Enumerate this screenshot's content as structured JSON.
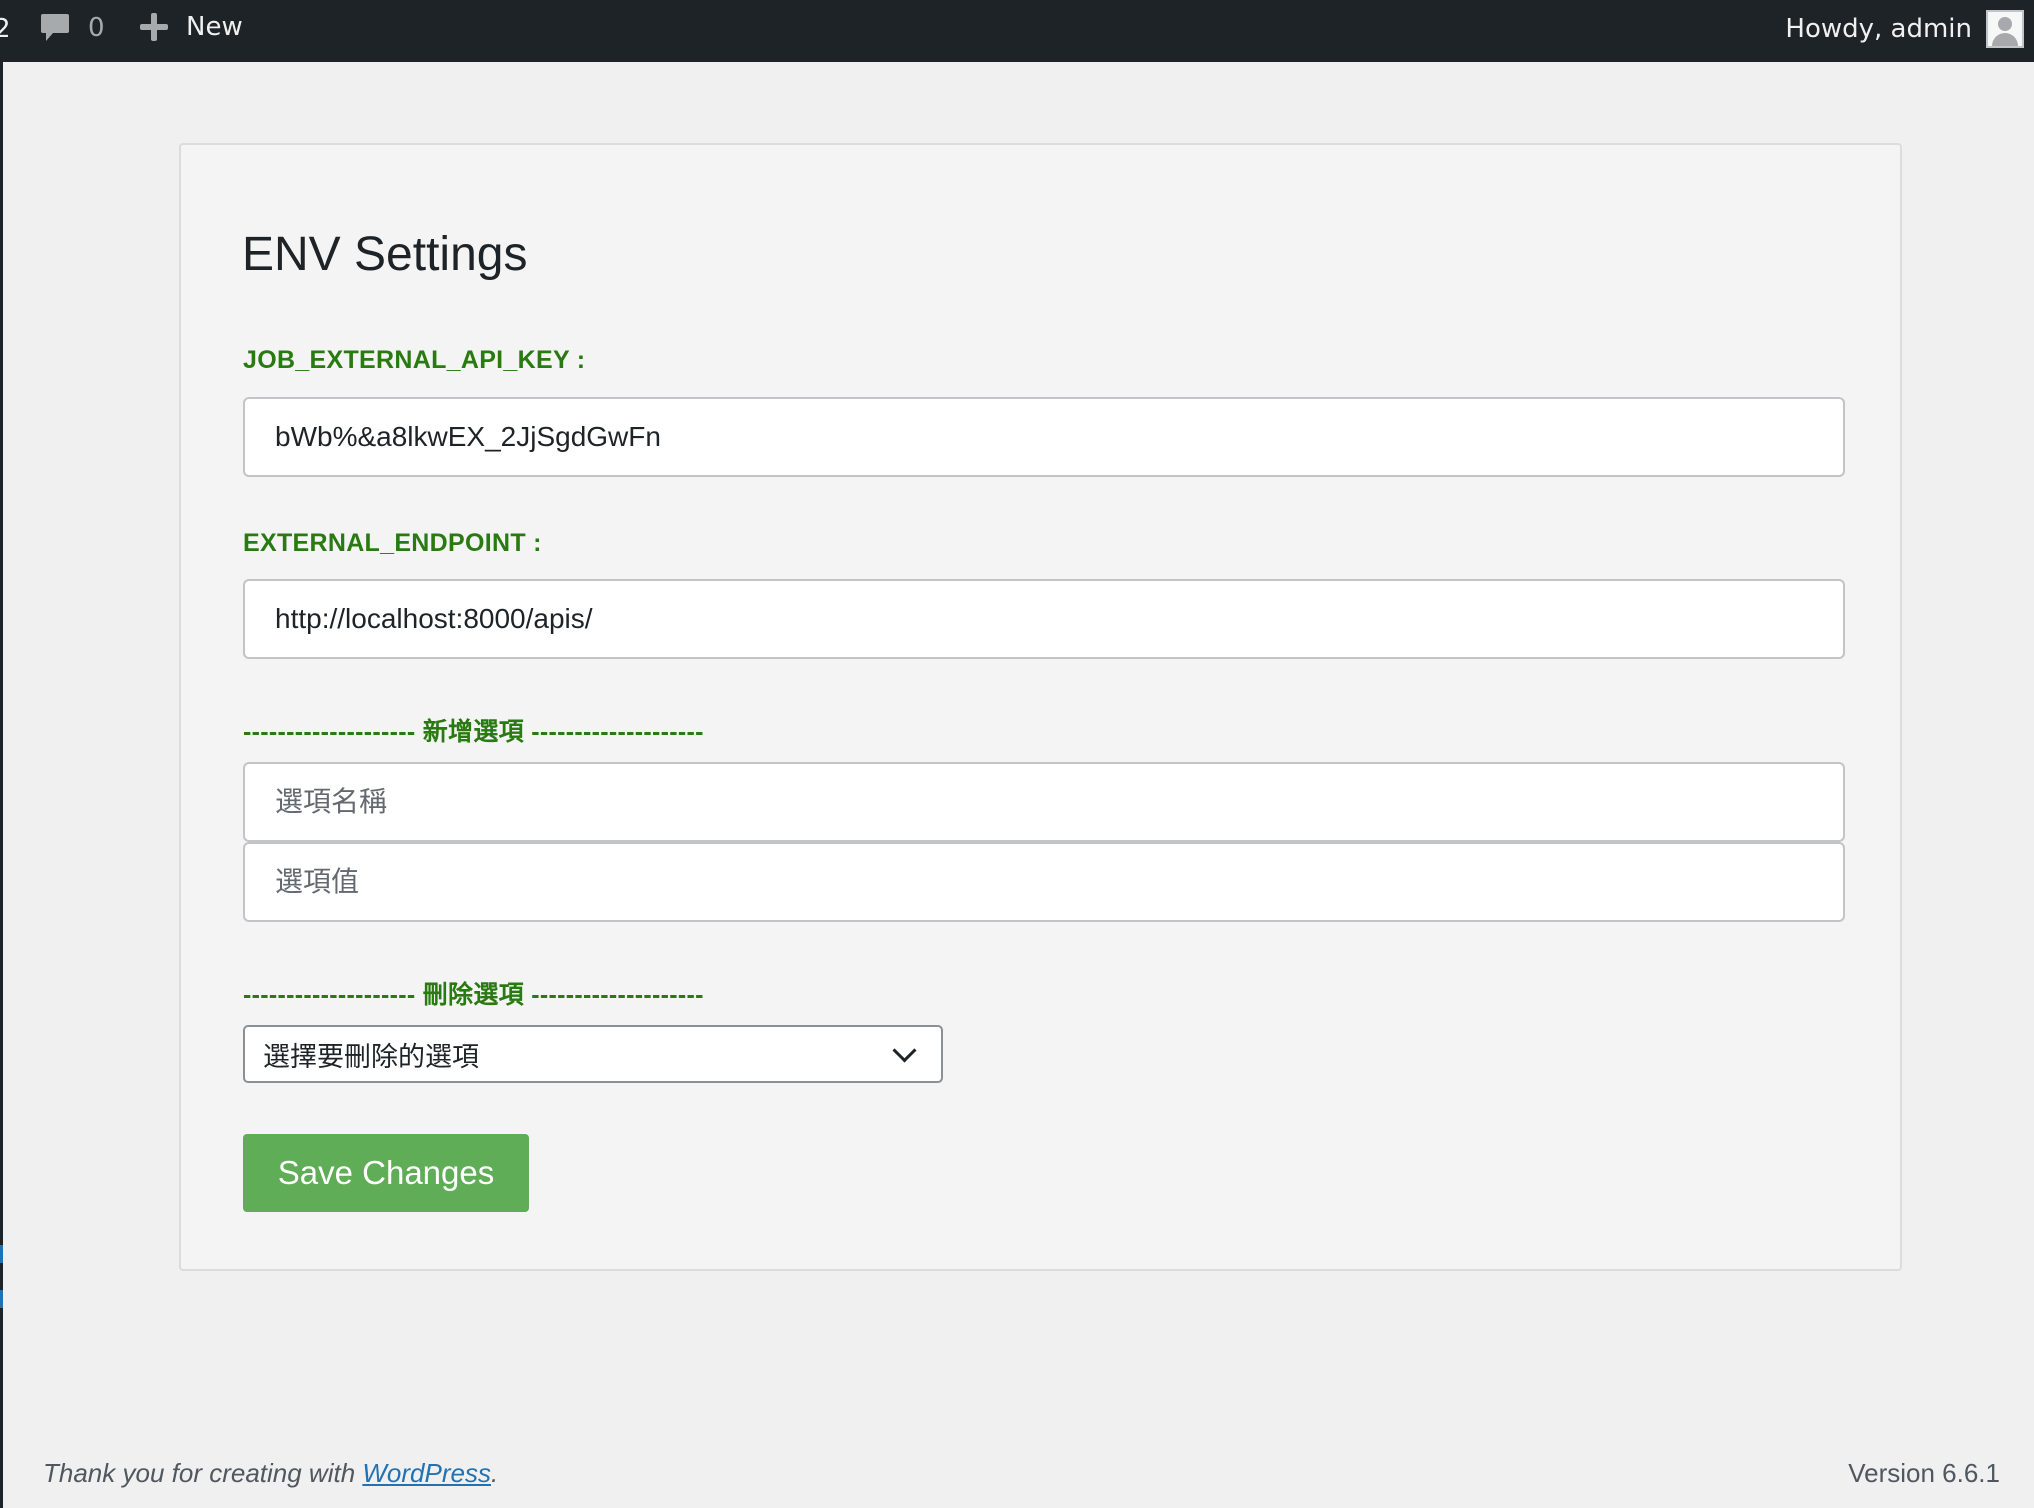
{
  "admin_bar": {
    "left_stub_text": "2",
    "comments_count": "0",
    "new_label": "New",
    "howdy_text": "Howdy, admin"
  },
  "settings": {
    "title": "ENV Settings",
    "api_key": {
      "label": "JOB_EXTERNAL_API_KEY :",
      "value": "bWb%&a8lkwEX_2JjSgdGwFn"
    },
    "endpoint": {
      "label": "EXTERNAL_ENDPOINT :",
      "value": "http://localhost:8000/apis/"
    },
    "add_section": {
      "heading": "-------------------- 新增選項 --------------------",
      "name_placeholder": "選項名稱",
      "value_placeholder": "選項值"
    },
    "delete_section": {
      "heading": "-------------------- 刪除選項 --------------------",
      "select_value": "選擇要刪除的選項"
    },
    "save_label": "Save Changes"
  },
  "footer": {
    "thanks_prefix": "Thank you for creating with ",
    "wordpress_link": "WordPress",
    "thanks_suffix": ".",
    "version": "Version 6.6.1"
  },
  "colors": {
    "adminbar_bg": "#1d2327",
    "page_bg": "#f0f0f1",
    "label_green": "#2a7a12",
    "button_green": "#5fad56",
    "link_blue": "#2271b1"
  }
}
